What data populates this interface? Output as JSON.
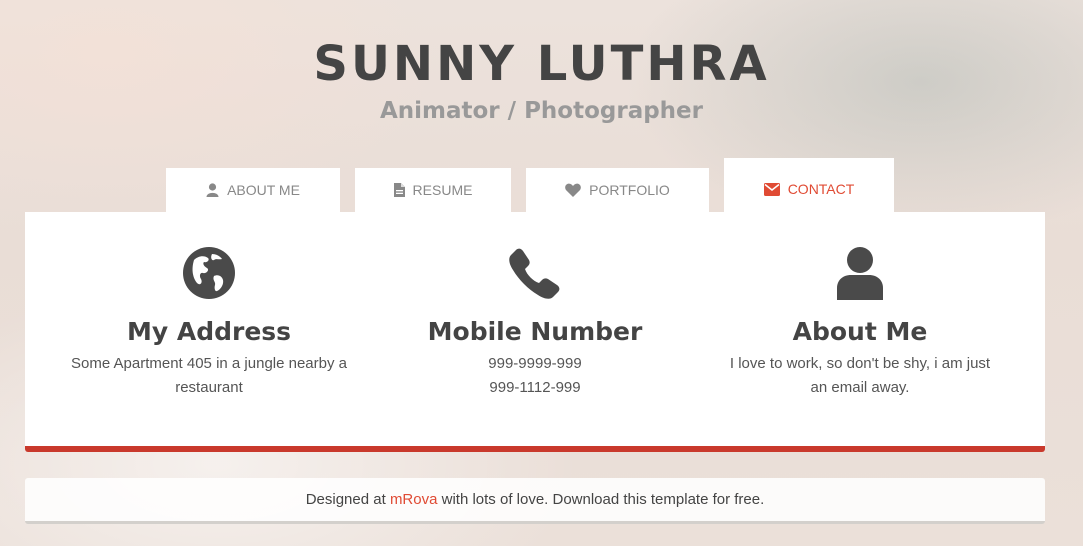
{
  "header": {
    "name": "SUNNY LUTHRA",
    "title": "Animator / Photographer"
  },
  "tabs": [
    {
      "label": "ABOUT ME",
      "icon": "user-icon",
      "active": false
    },
    {
      "label": "RESUME",
      "icon": "document-icon",
      "active": false
    },
    {
      "label": "PORTFOLIO",
      "icon": "heart-icon",
      "active": false
    },
    {
      "label": "CONTACT",
      "icon": "envelope-icon",
      "active": true
    }
  ],
  "contact": [
    {
      "icon": "globe-icon",
      "heading": "My Address",
      "lines": [
        "Some Apartment 405 in a jungle nearby a restaurant"
      ]
    },
    {
      "icon": "phone-icon",
      "heading": "Mobile Number",
      "lines": [
        "999-9999-999",
        "999-1112-999"
      ]
    },
    {
      "icon": "person-icon",
      "heading": "About Me",
      "lines": [
        "I love to work, so don't be shy, i am just an email away."
      ]
    }
  ],
  "footer": {
    "text_before": "Designed at ",
    "link": "mRova",
    "text_after": " with lots of love. Download this template for free."
  },
  "colors": {
    "accent": "#e04b34",
    "card_border": "#c9392c",
    "heading": "#444444",
    "subtitle": "#999999"
  }
}
